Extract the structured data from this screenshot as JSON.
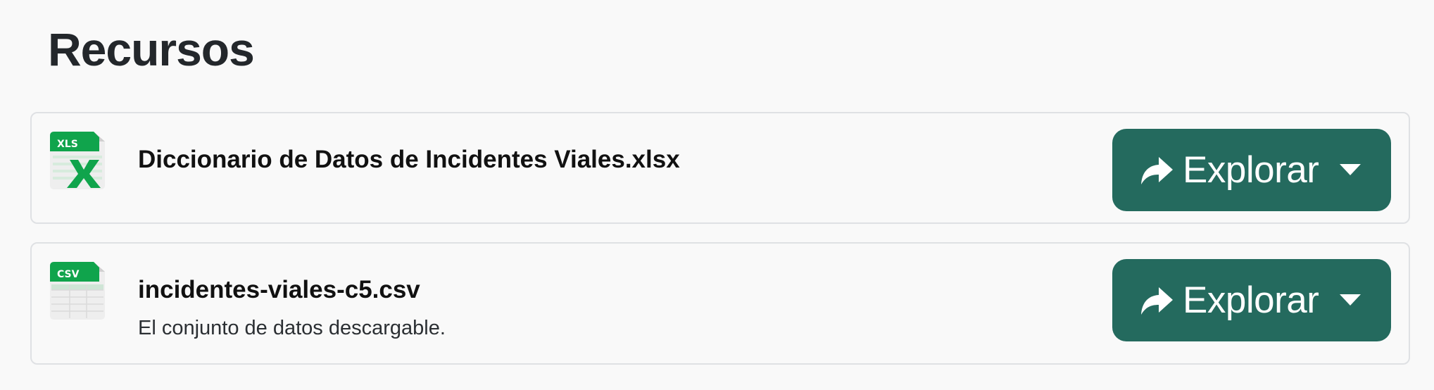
{
  "section": {
    "title": "Recursos"
  },
  "resources": [
    {
      "name": "Diccionario de Datos de Incidentes Viales.xlsx",
      "format_badge": "XLS",
      "format_icon": "xls-file-icon",
      "description": "",
      "button_label": "Explorar"
    },
    {
      "name": "incidentes-viales-c5.csv",
      "format_badge": "CSV",
      "format_icon": "csv-file-icon",
      "description": "El conjunto de datos descargable.",
      "button_label": "Explorar"
    }
  ],
  "colors": {
    "button_bg": "#246a5e",
    "badge_green": "#10a44c",
    "page_bg": "#f9f9f9",
    "card_border": "#dfe1e4"
  }
}
